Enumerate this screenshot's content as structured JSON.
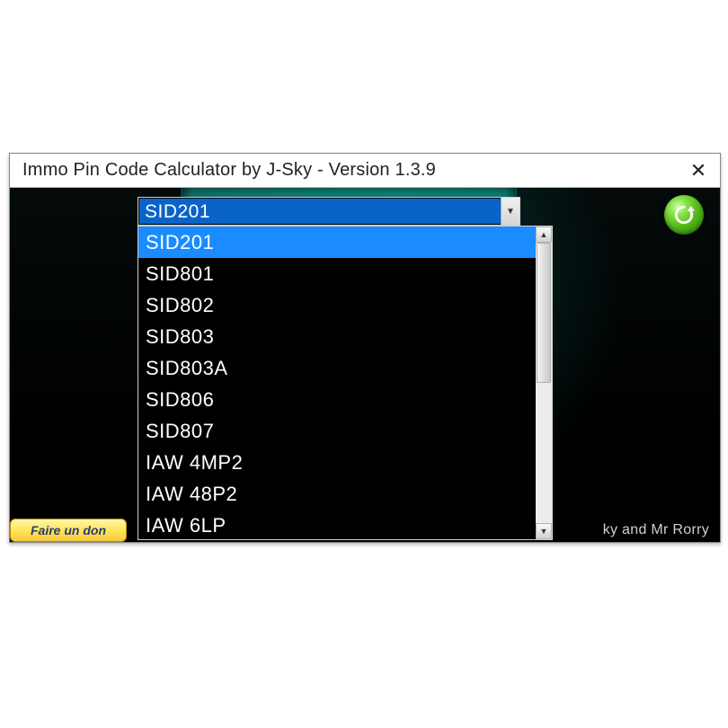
{
  "window": {
    "title": "Immo Pin Code Calculator by J-Sky  -  Version 1.3.9",
    "close_glyph": "✕"
  },
  "combo": {
    "selected": "SID201",
    "arrow_glyph": "▼",
    "options": [
      "SID201",
      "SID801",
      "SID802",
      "SID803",
      "SID803A",
      "SID806",
      "SID807",
      "IAW 4MP2",
      "IAW 48P2",
      "IAW 6LP"
    ],
    "highlight_index": 0
  },
  "scrollbar": {
    "up_glyph": "▲",
    "down_glyph": "▼"
  },
  "donate": {
    "label": "Faire un don"
  },
  "credits": {
    "text": "ky and Mr Rorry"
  },
  "colors": {
    "highlight": "#1a8cff",
    "accent_green": "#4fb516"
  }
}
